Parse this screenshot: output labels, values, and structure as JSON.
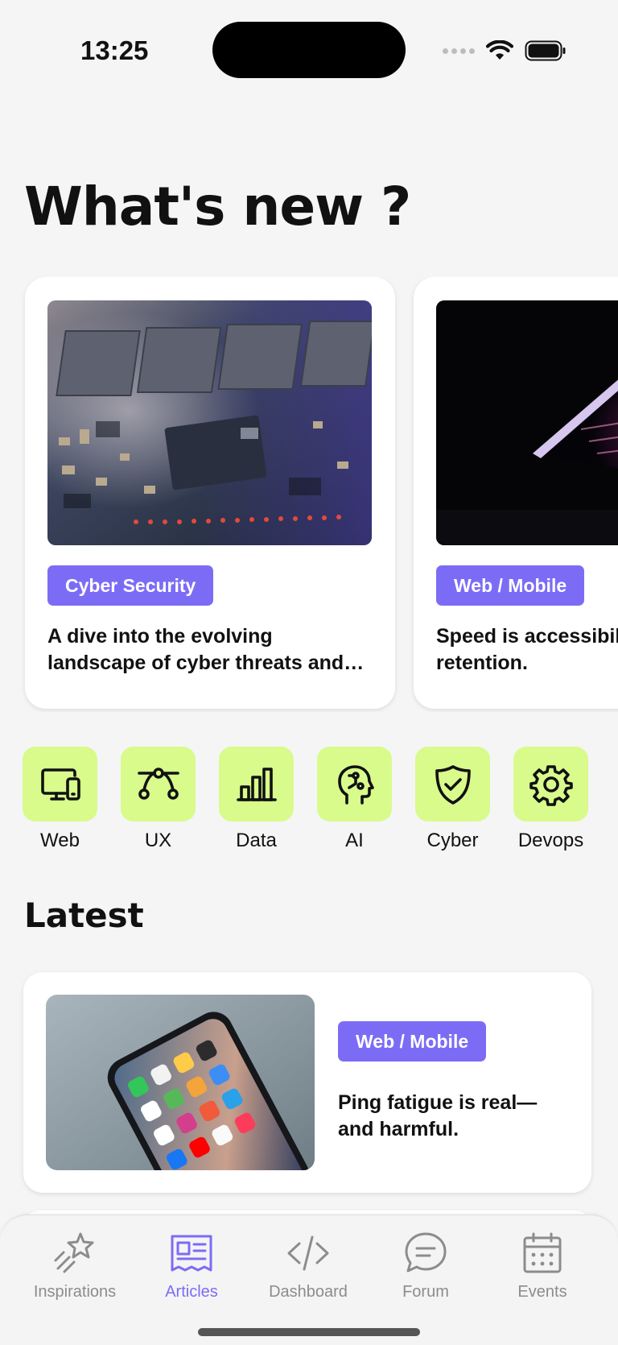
{
  "status_bar": {
    "time": "13:25",
    "icons": [
      "signal-dots-icon",
      "wifi-icon",
      "battery-icon"
    ]
  },
  "header": {
    "title": "What's new ?"
  },
  "featured": [
    {
      "tag": "Cyber Security",
      "title": "A dive into the evolving landscape of cyber threats and the ways to protect yourself",
      "image": "circuit-board-chip"
    },
    {
      "tag": "Web / Mobile",
      "title": "Speed is accessibility and retention.",
      "image": "laptop-dark-neon"
    }
  ],
  "categories": [
    {
      "label": "Web",
      "icon": "devices-icon"
    },
    {
      "label": "UX",
      "icon": "bezier-curve-icon"
    },
    {
      "label": "Data",
      "icon": "bar-chart-icon"
    },
    {
      "label": "AI",
      "icon": "brain-head-icon"
    },
    {
      "label": "Cyber",
      "icon": "shield-check-icon"
    },
    {
      "label": "Devops",
      "icon": "gear-icon"
    }
  ],
  "latest": {
    "section_title": "Latest",
    "items": [
      {
        "tag": "Web / Mobile",
        "title": "Ping fatigue is real—and harmful.",
        "image": "smartphone-home-screen"
      }
    ]
  },
  "tab_bar": {
    "tabs": [
      {
        "label": "Inspirations",
        "icon": "shooting-star-icon",
        "active": false
      },
      {
        "label": "Articles",
        "icon": "newspaper-icon",
        "active": true
      },
      {
        "label": "Dashboard",
        "icon": "code-icon",
        "active": false
      },
      {
        "label": "Forum",
        "icon": "chat-bubble-icon",
        "active": false
      },
      {
        "label": "Events",
        "icon": "calendar-icon",
        "active": false
      }
    ]
  },
  "colors": {
    "accent": "#7c6cf5",
    "category_tile": "#d8fb8c",
    "background": "#f5f5f5",
    "inactive_tab": "#8c8c8c"
  }
}
